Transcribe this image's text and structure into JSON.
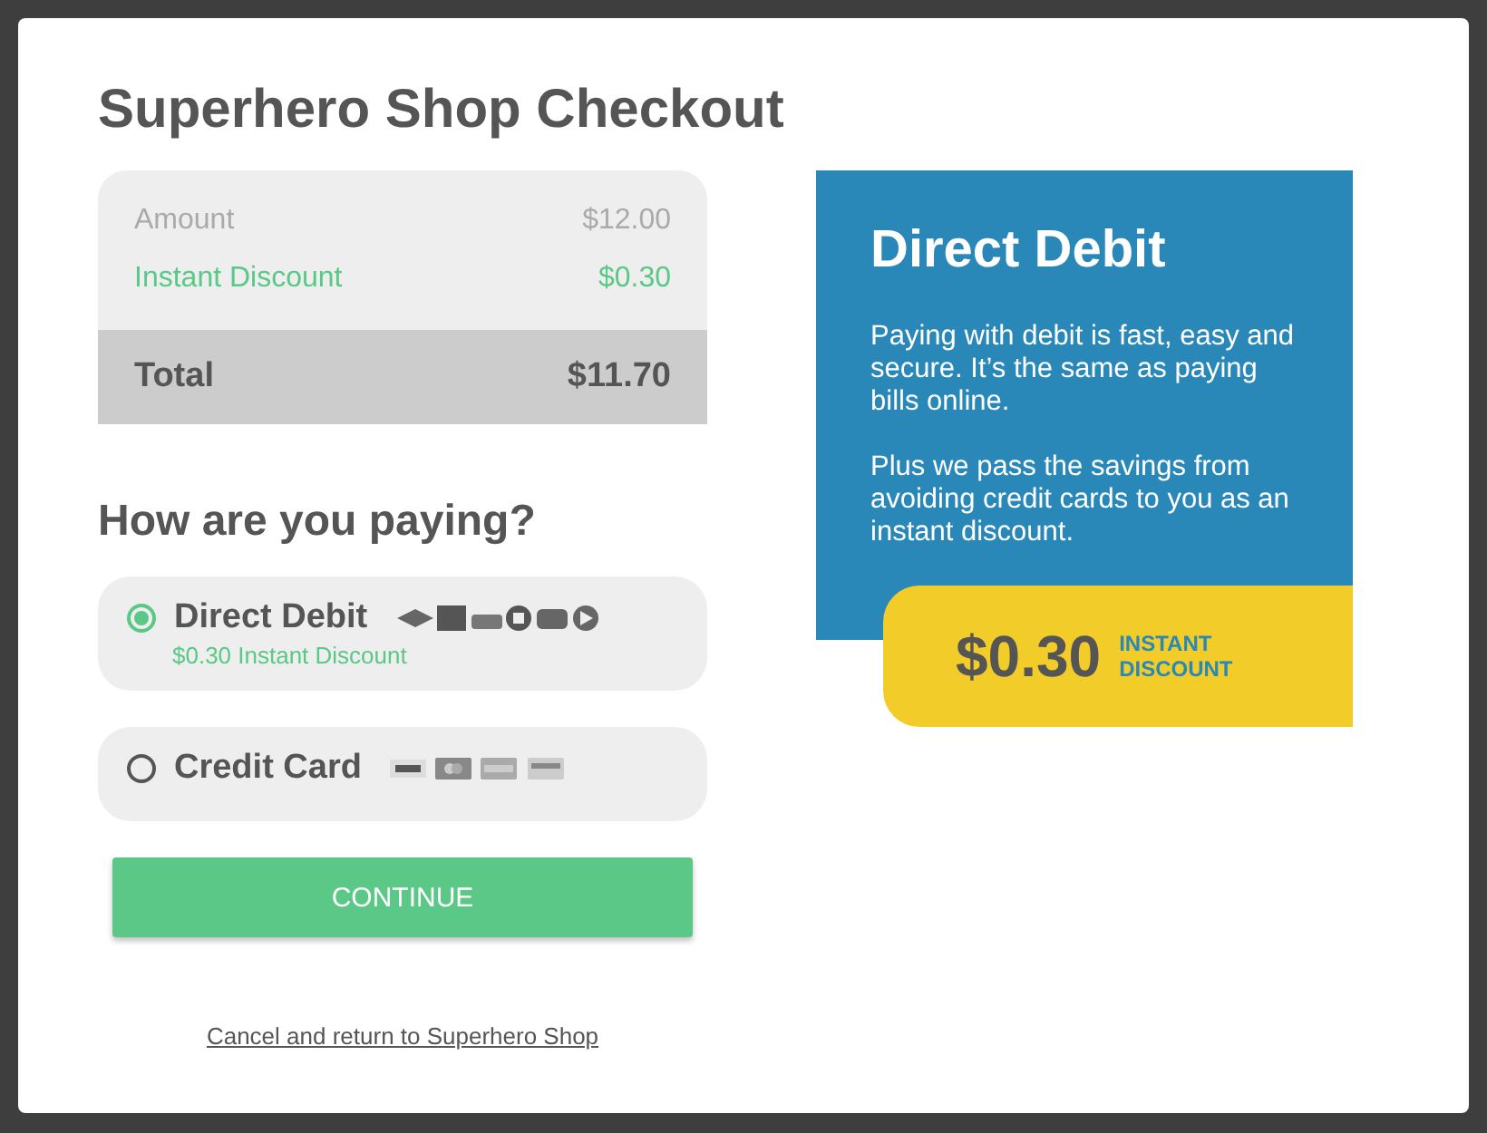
{
  "title": "Superhero Shop Checkout",
  "summary": {
    "lines": [
      {
        "kind": "base",
        "label": "Amount",
        "value": "$12.00"
      },
      {
        "kind": "discount",
        "label": "Instant Discount",
        "value": "$0.30"
      }
    ],
    "total": {
      "label": "Total",
      "value": "$11.70"
    }
  },
  "payment_heading": "How are you paying?",
  "payment_options": [
    {
      "label": "Direct Debit",
      "selected": true,
      "kind": "bank",
      "note": "$0.30 Instant Discount"
    },
    {
      "label": "Credit Card",
      "selected": false,
      "kind": "card"
    }
  ],
  "continue_button": "CONTINUE",
  "cancel_link": "Cancel and return to Superhero Shop",
  "info_panel": {
    "title": "Direct Debit",
    "paragraphs": [
      "Paying with debit is fast, easy and secure. It’s the same as paying bills online.",
      "Plus we pass the savings from avoiding credit cards to you as an instant discount."
    ],
    "badge": {
      "amount": "$0.30",
      "caption": "INSTANT DISCOUNT"
    }
  }
}
